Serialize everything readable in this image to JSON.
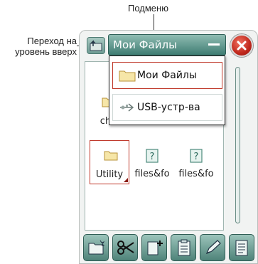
{
  "callouts": {
    "submenu": "Подменю",
    "go_up_line1": "Переход на",
    "go_up_line2": "уровень вверх"
  },
  "window": {
    "title": "Мои Файлы"
  },
  "files": [
    {
      "label": "chil",
      "icon": "folder-icon",
      "selected": false
    },
    {
      "label": "Utility",
      "icon": "folder-icon",
      "selected": true
    },
    {
      "label": "files&fo",
      "icon": "unknown-file-icon",
      "selected": false
    },
    {
      "label": "files&fo",
      "icon": "unknown-file-icon",
      "selected": false
    }
  ],
  "submenu": {
    "items": [
      {
        "label": "Мои Файлы",
        "icon": "folder-icon",
        "active": true
      },
      {
        "label": "USB-устр-ва",
        "icon": "usb-icon",
        "active": false
      }
    ]
  },
  "toolbar": {
    "buttons": [
      "new-folder-icon",
      "cut-icon",
      "paste-new-icon",
      "clipboard-icon",
      "pencil-icon",
      "document-icon"
    ]
  },
  "colors": {
    "accent": "#3f7d73",
    "selection": "#c0392b",
    "close": "#c0281c"
  }
}
